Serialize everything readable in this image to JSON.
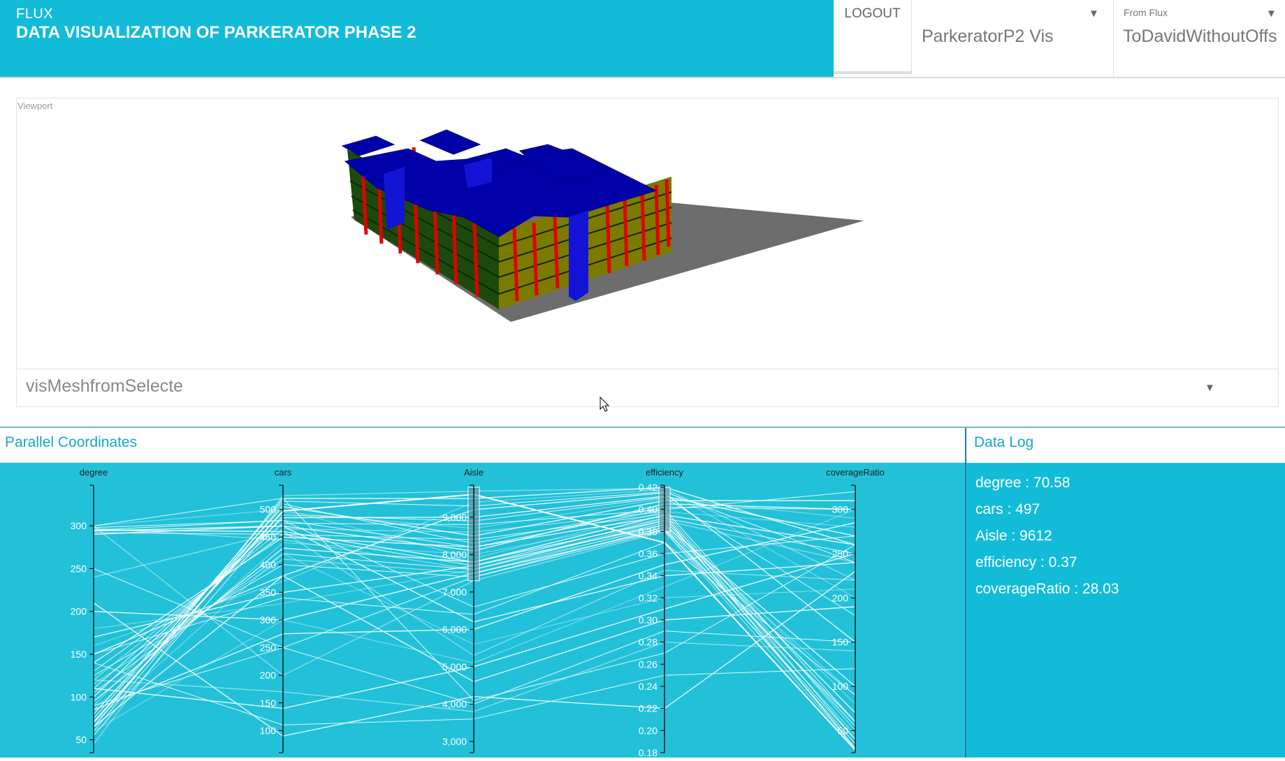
{
  "header": {
    "app_name": "FLUX",
    "app_title": "DATA VISUALIZATION OF PARKERATOR PHASE 2",
    "logout_label": "LOGOUT",
    "project_select": {
      "value": "ParkeratorP2 Vis"
    },
    "key_select": {
      "label": "From Flux",
      "value": "ToDavidWithoutOffs"
    }
  },
  "viewport": {
    "label": "Viewport",
    "mesh_select_value": "visMeshfromSelecte"
  },
  "parallel_coordinates": {
    "title": "Parallel Coordinates"
  },
  "data_log": {
    "title": "Data Log",
    "entries": [
      {
        "text": "degree : 70.58"
      },
      {
        "text": "cars : 497"
      },
      {
        "text": "Aisle : 9612"
      },
      {
        "text": "efficiency : 0.37"
      },
      {
        "text": "coverageRatio : 28.03"
      }
    ]
  },
  "colors": {
    "brand": "#12bcd9",
    "panel_bg": "#22c1d9",
    "slab": "#0000a8",
    "column": "#e00000",
    "ground": "#6d6d6d"
  },
  "chart_data": {
    "type": "parallel_coordinates",
    "axes": [
      {
        "name": "degree",
        "ticks": [
          "50",
          "100",
          "150",
          "200",
          "250",
          "300"
        ],
        "range": [
          35,
          345
        ]
      },
      {
        "name": "cars",
        "ticks": [
          "100",
          "150",
          "200",
          "250",
          "300",
          "350",
          "400",
          "450",
          "500"
        ],
        "range": [
          60,
          540
        ]
      },
      {
        "name": "Aisle",
        "ticks": [
          "3,000",
          "4,000",
          "5,000",
          "6,000",
          "7,000",
          "8,000",
          "9,000"
        ],
        "range": [
          2700,
          9800
        ]
      },
      {
        "name": "efficiency",
        "ticks": [
          "0.18",
          "0.20",
          "0.22",
          "0.24",
          "0.26",
          "0.28",
          "0.30",
          "0.32",
          "0.34",
          "0.36",
          "0.38",
          "0.40",
          "0.42"
        ],
        "range": [
          0.18,
          0.42
        ]
      },
      {
        "name": "coverageRatio",
        "ticks": [
          "50",
          "100",
          "150",
          "200",
          "250",
          "300"
        ],
        "range": [
          25,
          325
        ]
      }
    ],
    "brushes": [
      {
        "axis": "Aisle",
        "from": 7300,
        "to": 9800
      },
      {
        "axis": "efficiency",
        "from": 0.38,
        "to": 0.42
      }
    ],
    "records": [
      [
        70.58,
        497,
        9612,
        0.37,
        28.03
      ],
      [
        295,
        480,
        8200,
        0.4,
        320
      ],
      [
        290,
        470,
        8100,
        0.405,
        300
      ],
      [
        300,
        500,
        7900,
        0.398,
        280
      ],
      [
        295,
        460,
        7800,
        0.395,
        260
      ],
      [
        292,
        455,
        7700,
        0.392,
        250
      ],
      [
        297,
        445,
        7600,
        0.39,
        240
      ],
      [
        60,
        510,
        8300,
        0.402,
        300
      ],
      [
        80,
        505,
        8500,
        0.408,
        310
      ],
      [
        90,
        495,
        8700,
        0.41,
        290
      ],
      [
        100,
        485,
        9000,
        0.412,
        270
      ],
      [
        110,
        475,
        8800,
        0.4,
        60
      ],
      [
        120,
        465,
        8600,
        0.398,
        50
      ],
      [
        130,
        455,
        8400,
        0.396,
        40
      ],
      [
        140,
        450,
        8200,
        0.394,
        30
      ],
      [
        85,
        440,
        8000,
        0.392,
        80
      ],
      [
        95,
        430,
        7800,
        0.39,
        70
      ],
      [
        105,
        420,
        7600,
        0.388,
        55
      ],
      [
        115,
        410,
        7500,
        0.386,
        45
      ],
      [
        125,
        400,
        7400,
        0.384,
        35
      ],
      [
        150,
        380,
        9200,
        0.415,
        150
      ],
      [
        160,
        370,
        9400,
        0.418,
        200
      ],
      [
        65,
        520,
        9500,
        0.42,
        260
      ],
      [
        75,
        515,
        9300,
        0.416,
        240
      ],
      [
        45,
        525,
        9700,
        0.419,
        220
      ],
      [
        55,
        490,
        8900,
        0.411,
        180
      ],
      [
        170,
        350,
        7700,
        0.386,
        100
      ],
      [
        180,
        330,
        7600,
        0.384,
        90
      ],
      [
        200,
        300,
        7500,
        0.382,
        60
      ],
      [
        250,
        250,
        7400,
        0.381,
        40
      ],
      [
        300,
        200,
        7300,
        0.38,
        30
      ],
      [
        298,
        480,
        6600,
        0.36,
        270
      ],
      [
        294,
        470,
        6200,
        0.34,
        240
      ],
      [
        70,
        420,
        5600,
        0.32,
        210
      ],
      [
        65,
        380,
        4600,
        0.3,
        190
      ],
      [
        90,
        250,
        4000,
        0.29,
        150
      ],
      [
        120,
        170,
        3800,
        0.28,
        140
      ],
      [
        140,
        110,
        3600,
        0.25,
        120
      ],
      [
        210,
        90,
        4200,
        0.22,
        230
      ],
      [
        60,
        300,
        5100,
        0.33,
        300
      ],
      [
        85,
        275,
        6000,
        0.35,
        285
      ],
      [
        300,
        520,
        4100,
        0.27,
        260
      ],
      [
        240,
        460,
        5300,
        0.345,
        220
      ],
      [
        150,
        340,
        6400,
        0.37,
        90
      ],
      [
        110,
        140,
        5000,
        0.31,
        250
      ]
    ]
  }
}
